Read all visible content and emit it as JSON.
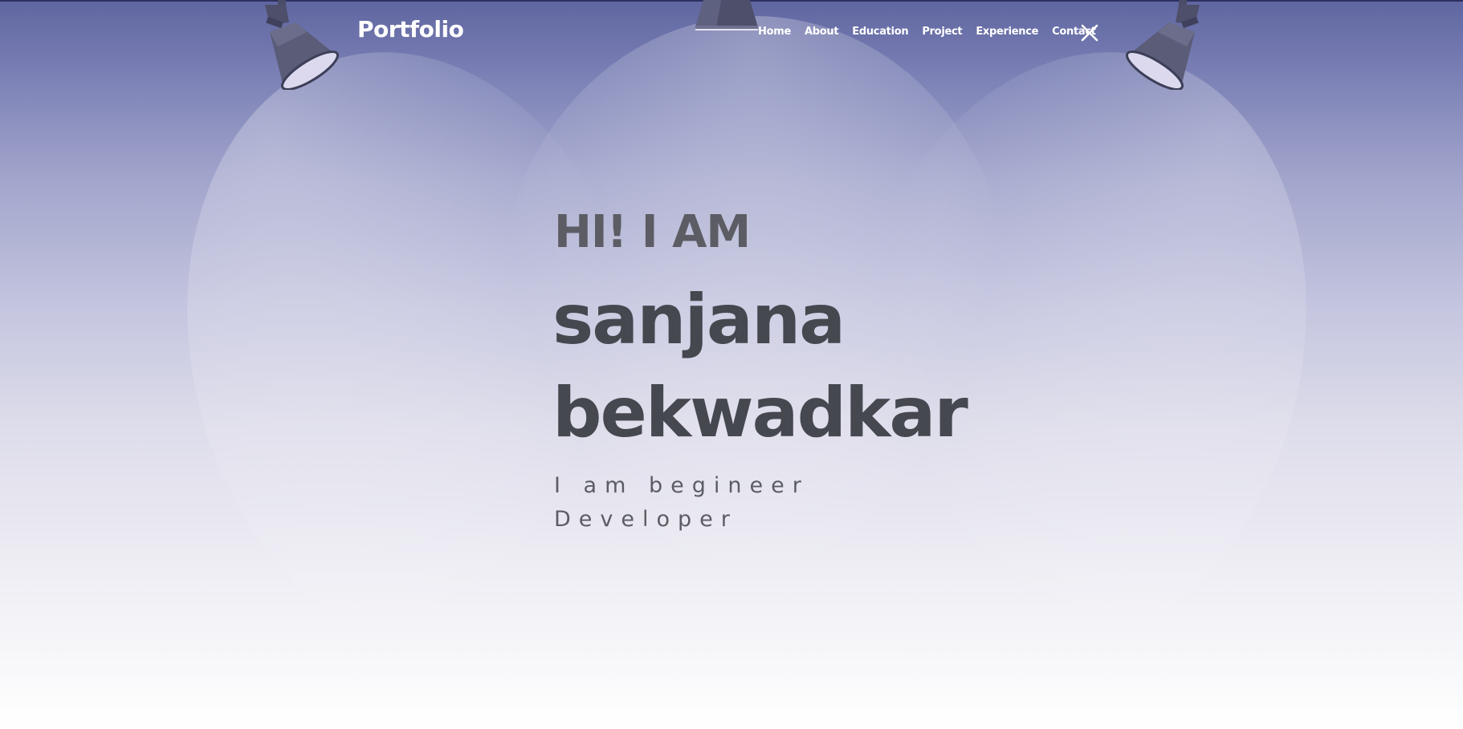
{
  "header": {
    "logo": "Portfolio",
    "nav": [
      "Home",
      "About",
      "Education",
      "Project",
      "Experience",
      "Contact"
    ],
    "close_icon": "close-icon"
  },
  "hero": {
    "greeting": "HI! I AM",
    "first_name": "sanjana",
    "last_name": "bekwadkar",
    "subtitle": "I am begineer Developer"
  },
  "colors": {
    "background_top": "#5f659f",
    "background_bottom": "#ffffff",
    "nav_text": "#ffffff",
    "heading_text": "#464850",
    "greeting_text": "#5c5d64"
  }
}
